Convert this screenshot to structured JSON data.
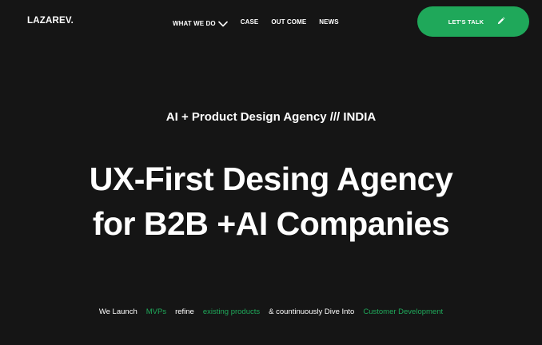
{
  "header": {
    "logo": "LAZAREV.",
    "nav": [
      {
        "label": "WHAT WE DO",
        "icon": "chevron-down-icon"
      },
      {
        "label": "CASE"
      },
      {
        "label": "OUT COME"
      },
      {
        "label": "NEWS"
      }
    ],
    "cta": {
      "label": "LET'S TALK",
      "icon": "pencil-icon"
    }
  },
  "hero": {
    "tagline": "AI + Product Design Agency /// INDIA",
    "headline_line1": "UX-First Desing Agency",
    "headline_line2": "for B2B +AI Companies",
    "subline": {
      "part1": "We Launch",
      "part2": "MVPs",
      "part3": "refine",
      "part4": "existing products",
      "part5": "& countinuously Dive Into",
      "part6": "Customer Development"
    }
  },
  "colors": {
    "background": "#151515",
    "accent": "#1fa85a",
    "text": "#ffffff"
  }
}
